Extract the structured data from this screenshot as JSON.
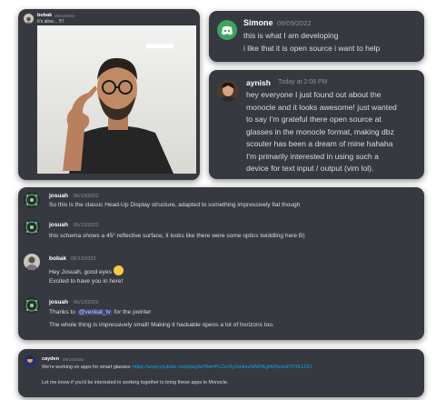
{
  "card_bobak_photo": {
    "username": "bobak",
    "date": "06/13/2022",
    "text": "It's alive... !!!!"
  },
  "card_simone": {
    "username": "Simone",
    "date": "09/09/2022",
    "lines": [
      "this is what I am developing",
      "i like that it is open source i want to help"
    ]
  },
  "card_aynish": {
    "username": "aynish",
    "date": "Today at 2:08 PM",
    "lines": [
      "hey everyone I just found out about the",
      "monocle and it looks awesome! just wanted",
      "to say I'm grateful there open source at",
      "glasses in the monocle format, making dbz",
      "scouter has been a dream of mine hahaha",
      "I'm primarily interested in using such a",
      "device for text input / output (vim lol)."
    ]
  },
  "card_thread": {
    "messages": [
      {
        "username": "josuah",
        "date": "06/13/2022",
        "text": "So this is the classic Head-Up Display structure, adapted to something impressively flat though"
      },
      {
        "username": "josuah",
        "date": "06/13/2022",
        "text": "this schema shows a 45° reflective surface, it looks like there were some optics twiddling here B)"
      },
      {
        "username": "bobak",
        "date": "06/13/2022",
        "text": "Hey Josuah, good eyes",
        "text2": "Excited to have you in here!"
      },
      {
        "username": "josuah",
        "date": "06/13/2022",
        "text_pre": "Thanks to",
        "mention": "@venkat_tv",
        "text_post": "for the pointer",
        "text2": "The whole thing is impressively small! Making it hackable opens a lot of horizons too."
      }
    ]
  },
  "card_cayden": {
    "username": "cayden",
    "date": "09/19/2022",
    "text_pre": "We're working on apps for smart glasses:",
    "link": "https://www.youtube.com/playlist?list=PLCeVty2nHmaSfMXKghM3extoP3YIE1Z3J",
    "text2": "Let me know if you'd be interested in working together to bring these apps to Monocle."
  },
  "colors": {
    "card_bg": "#36393f",
    "discord_blue": "#5865f2",
    "link": "#00aff4",
    "mention_bg": "#5865f2"
  }
}
